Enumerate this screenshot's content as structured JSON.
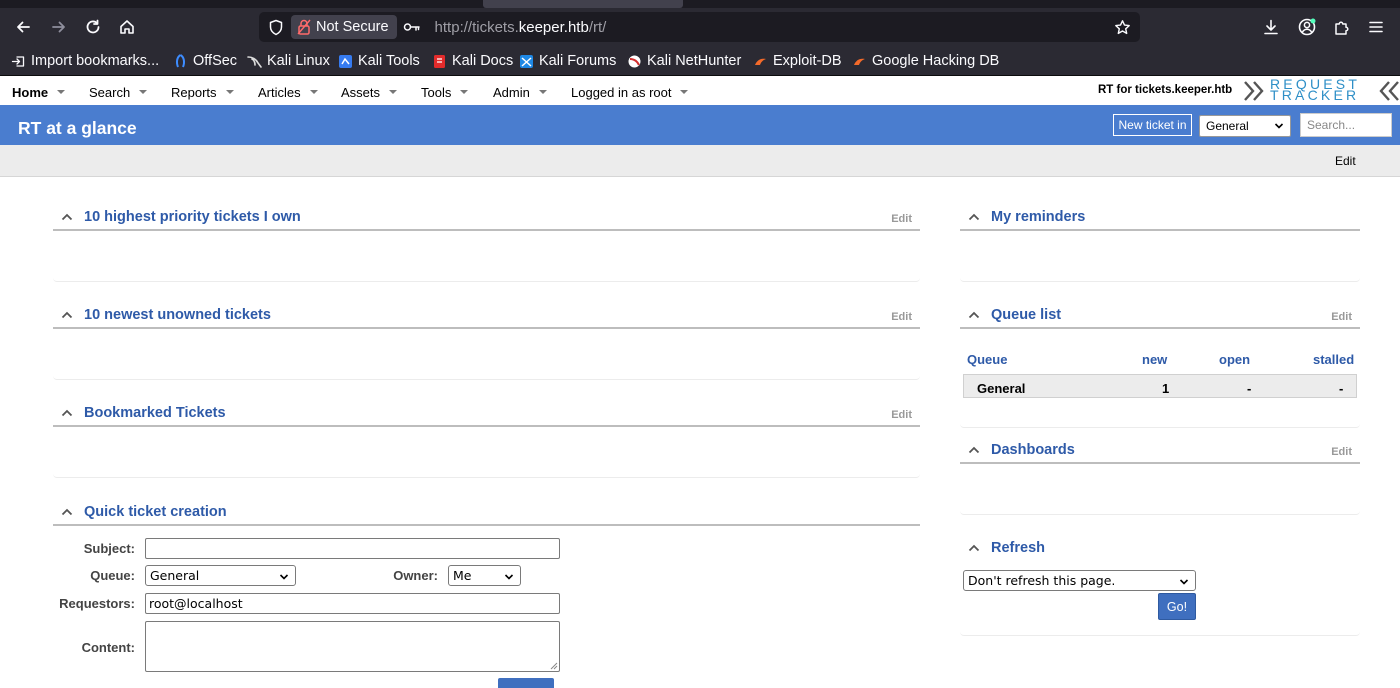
{
  "browser": {
    "security_label": "Not Secure",
    "url_prefix": "http://tickets.",
    "url_host": "keeper.htb",
    "url_path": "/rt/",
    "bookmarks": [
      {
        "label": "Import bookmarks...",
        "icon": "import-icon"
      },
      {
        "label": "OffSec",
        "icon": "offsec-icon"
      },
      {
        "label": "Kali Linux",
        "icon": "kali-dragon-icon"
      },
      {
        "label": "Kali Tools",
        "icon": "kali-tools-icon"
      },
      {
        "label": "Kali Docs",
        "icon": "kali-docs-icon"
      },
      {
        "label": "Kali Forums",
        "icon": "kali-forums-icon"
      },
      {
        "label": "Kali NetHunter",
        "icon": "nethunter-icon"
      },
      {
        "label": "Exploit-DB",
        "icon": "exploit-db-icon"
      },
      {
        "label": "Google Hacking DB",
        "icon": "ghdb-icon"
      }
    ]
  },
  "rt": {
    "menu": [
      {
        "label": "Home"
      },
      {
        "label": "Search"
      },
      {
        "label": "Reports"
      },
      {
        "label": "Articles"
      },
      {
        "label": "Assets"
      },
      {
        "label": "Tools"
      },
      {
        "label": "Admin"
      },
      {
        "label": "Logged in as root"
      }
    ],
    "rt_for": "RT for tickets.keeper.htb",
    "logo_line1": "REQUEST",
    "logo_line2": "TRACKER",
    "page_title": "RT at a glance",
    "new_ticket_label": "New ticket in",
    "queue_selected": "General",
    "search_placeholder": "Search...",
    "subbar_edit": "Edit",
    "boxes": {
      "priority": {
        "title": "10 highest priority tickets I own",
        "edit": "Edit"
      },
      "newest": {
        "title": "10 newest unowned tickets",
        "edit": "Edit"
      },
      "bookmarked": {
        "title": "Bookmarked Tickets",
        "edit": "Edit"
      },
      "quick": {
        "title": "Quick ticket creation"
      },
      "reminders": {
        "title": "My reminders"
      },
      "queuelist": {
        "title": "Queue list",
        "edit": "Edit"
      },
      "dashboards": {
        "title": "Dashboards",
        "edit": "Edit"
      },
      "refresh": {
        "title": "Refresh"
      }
    },
    "quick_form": {
      "subject_label": "Subject:",
      "subject_value": "",
      "queue_label": "Queue:",
      "queue_value": "General",
      "owner_label": "Owner:",
      "owner_value": "Me",
      "requestors_label": "Requestors:",
      "requestors_value": "root@localhost",
      "content_label": "Content:",
      "content_value": ""
    },
    "queue_list": {
      "headers": [
        "Queue",
        "new",
        "open",
        "stalled"
      ],
      "rows": [
        {
          "queue": "General",
          "new": "1",
          "open": "-",
          "stalled": "-"
        }
      ]
    },
    "refresh": {
      "selected": "Don't refresh this page.",
      "go_label": "Go!"
    }
  },
  "colors": {
    "rt_blue": "#4a7dcf",
    "link_blue": "#2e5aa8",
    "browser_chrome": "#2b2a33"
  }
}
